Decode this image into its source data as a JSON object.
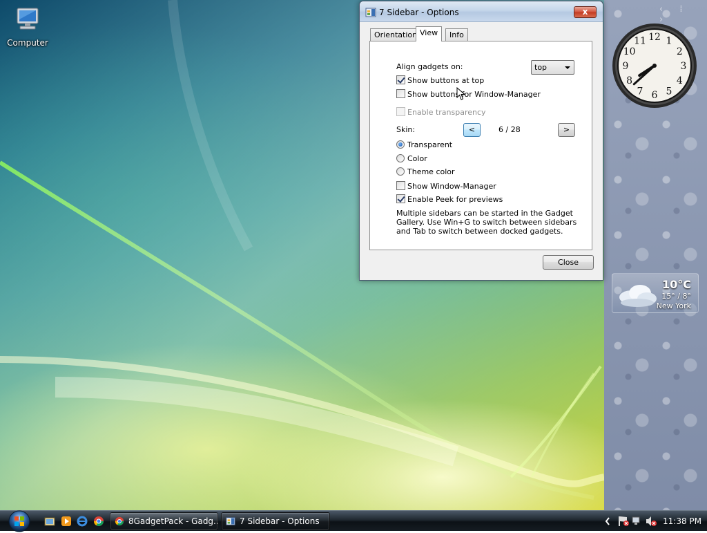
{
  "desktop": {
    "icons": [
      {
        "label": "Computer",
        "icon": "computer-icon"
      }
    ]
  },
  "dialog": {
    "title": "7 Sidebar - Options",
    "close_glyph": "x",
    "tabs": [
      {
        "label": "Orientation",
        "active": false
      },
      {
        "label": "View",
        "active": true
      },
      {
        "label": "Info",
        "active": false
      }
    ],
    "view": {
      "align_label": "Align gadgets on:",
      "align_value": "top",
      "show_buttons_top": {
        "label": "Show buttons at top",
        "checked": true
      },
      "show_buttons_wm": {
        "label": "Show buttons for Window-Manager",
        "checked": false
      },
      "enable_transparency": {
        "label": "Enable transparency",
        "checked": false,
        "disabled": true
      },
      "skin_label": "Skin:",
      "skin_prev": "<",
      "skin_next": ">",
      "skin_count": "6 / 28",
      "radios": [
        {
          "label": "Transparent",
          "selected": true
        },
        {
          "label": "Color",
          "selected": false
        },
        {
          "label": "Theme color",
          "selected": false
        }
      ],
      "show_wm": {
        "label": "Show Window-Manager",
        "checked": false
      },
      "enable_peek": {
        "label": "Enable Peek for previews",
        "checked": true
      },
      "info_text": "Multiple sidebars can be started in the Gadget Gallery. Use Win+G to switch between sidebars and Tab to switch between docked gadgets."
    },
    "close_label": "Close"
  },
  "sidebar": {
    "nav": "‹ ⁞ ›",
    "clock": {
      "numbers": [
        "12",
        "1",
        "2",
        "3",
        "4",
        "5",
        "6",
        "7",
        "8",
        "9",
        "10",
        "11"
      ],
      "hour": 7.9,
      "minute": 38
    },
    "weather": {
      "temp": "10°C",
      "range": "15° / 8°",
      "city": "New York"
    }
  },
  "taskbar": {
    "tasks": [
      {
        "label": "8GadgetPack - Gadg...",
        "icon": "chrome-icon",
        "active": false
      },
      {
        "label": "7 Sidebar - Options",
        "icon": "sidebar-app-icon",
        "active": true
      }
    ],
    "time": "11:38 PM"
  },
  "colors": {
    "accent": "#3c7fb1",
    "titlebar": "#c5d6ea",
    "close_red": "#c23a22",
    "taskbar": "#1f2830"
  }
}
